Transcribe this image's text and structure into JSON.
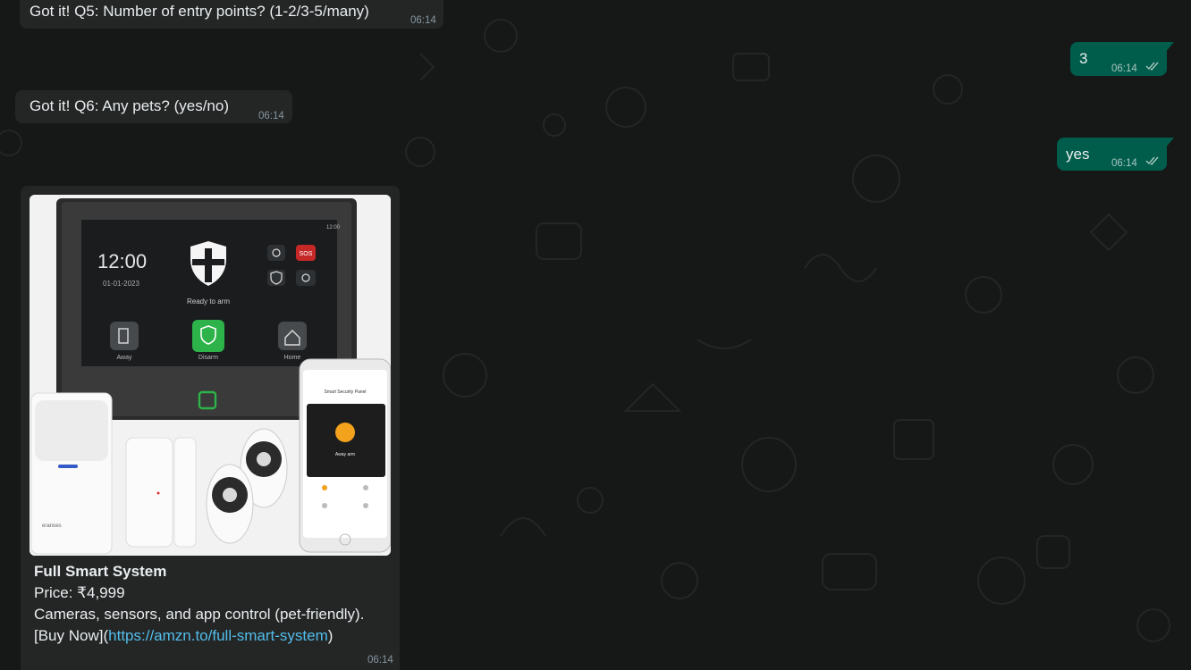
{
  "messages": {
    "q5": {
      "text": "Got it! Q5: Number of entry points? (1-2/3-5/many)",
      "time": "06:14"
    },
    "a5": {
      "text": "3",
      "time": "06:14"
    },
    "q6": {
      "text": "Got it! Q6: Any pets? (yes/no)",
      "time": "06:14"
    },
    "a6": {
      "text": "yes",
      "time": "06:14"
    },
    "product": {
      "title": "Full Smart System",
      "price": "Price: ₹4,999",
      "description": "Cameras, sensors, and app control (pet-friendly).",
      "buy_prefix": "[Buy Now](",
      "link": "https://amzn.to/full-smart-system",
      "buy_suffix": ")",
      "time": "06:14",
      "image": {
        "panel_time": "12:00",
        "panel_date": "01-01-2023",
        "panel_status": "Ready to arm",
        "panel_clock": "12:00",
        "sos": "SOS",
        "buttons": [
          "Away",
          "Disarm",
          "Home"
        ],
        "phone_title": "Smart Security Panel",
        "phone_mode": "Away arm",
        "sensor_brand": "eranoes"
      }
    }
  },
  "colors": {
    "outgoing": "#005c4b",
    "incoming": "#242626",
    "link": "#53bdeb",
    "background": "#161717"
  }
}
